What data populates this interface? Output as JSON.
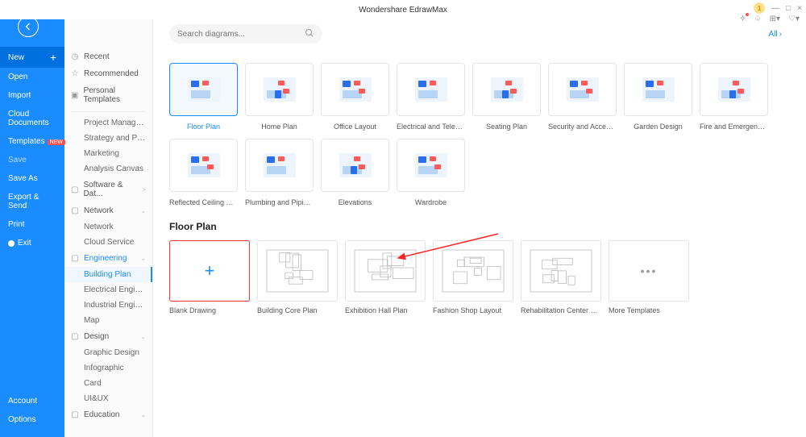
{
  "app_title": "Wondershare EdrawMax",
  "window": {
    "badge_value": "1",
    "min": "—",
    "max": "□",
    "close": "×"
  },
  "toolbar_icons": {
    "clock": "⏱",
    "bell": "🔔",
    "grid": "▦",
    "cart": "🛒"
  },
  "blue_sidebar": {
    "new": "New",
    "open": "Open",
    "import": "Import",
    "cloud_documents": "Cloud Documents",
    "templates": "Templates",
    "templates_badge": "NEW",
    "save": "Save",
    "save_as": "Save As",
    "export_send": "Export & Send",
    "print": "Print",
    "exit": "Exit",
    "account": "Account",
    "options": "Options"
  },
  "cat_sidebar": {
    "recent": "Recent",
    "recommended": "Recommended",
    "personal_templates": "Personal Templates",
    "groups": [
      {
        "title": "",
        "subs": [
          "Project Management",
          "Strategy and Planni...",
          "Marketing",
          "Analysis Canvas"
        ]
      },
      {
        "title": "Software & Dat...",
        "chev": ">",
        "subs": []
      },
      {
        "title": "Network",
        "chev": "⌄",
        "subs": [
          "Network",
          "Cloud Service"
        ]
      },
      {
        "title": "Engineering",
        "chev": "⌄",
        "active": true,
        "subs": [
          {
            "label": "Building Plan",
            "active": true
          },
          {
            "label": "Electrical Engineering"
          },
          {
            "label": "Industrial Engineeri..."
          },
          {
            "label": "Map"
          }
        ]
      },
      {
        "title": "Design",
        "chev": "⌄",
        "subs": [
          "Graphic Design",
          "Infographic",
          "Card",
          "UI&UX"
        ]
      },
      {
        "title": "Education",
        "chev": "⌄",
        "subs": []
      }
    ]
  },
  "search": {
    "placeholder": "Search diagrams..."
  },
  "all_link": "All",
  "category_cards_row1": [
    {
      "label": "Floor Plan",
      "active": true
    },
    {
      "label": "Home Plan"
    },
    {
      "label": "Office Layout"
    },
    {
      "label": "Electrical and Telecom..."
    },
    {
      "label": "Seating Plan"
    },
    {
      "label": "Security and Access Pl..."
    },
    {
      "label": "Garden Design"
    },
    {
      "label": "Fire and Emergency Pl..."
    }
  ],
  "category_cards_row2": [
    {
      "label": "Reflected Ceiling Plan"
    },
    {
      "label": "Plumbing and Piping ..."
    },
    {
      "label": "Elevations"
    },
    {
      "label": "Wardrobe"
    }
  ],
  "section_title": "Floor Plan",
  "templates": [
    {
      "label": "Blank Drawing",
      "kind": "blank"
    },
    {
      "label": "Building Core Plan",
      "kind": "fp"
    },
    {
      "label": "Exhibition Hall Plan",
      "kind": "fp"
    },
    {
      "label": "Fashion Shop Layout",
      "kind": "fp"
    },
    {
      "label": "Rehabilitation Center Floor Pl...",
      "kind": "fp"
    },
    {
      "label": "More Templates",
      "kind": "more"
    }
  ]
}
